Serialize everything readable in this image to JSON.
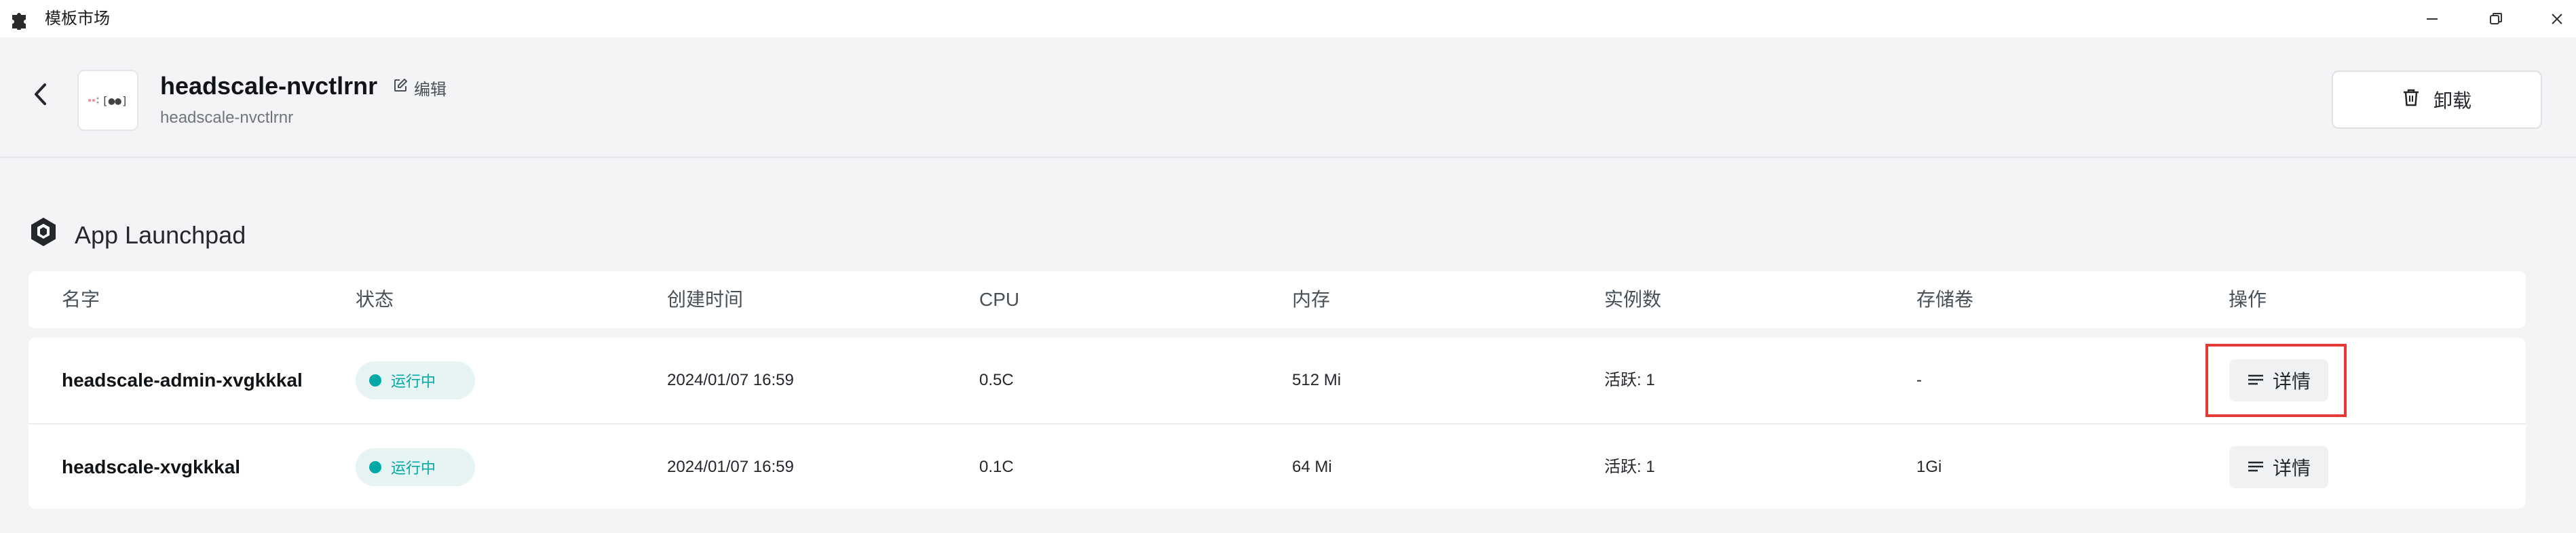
{
  "window": {
    "title": "模板市场",
    "icon": "puzzle-icon",
    "controls": [
      "minimize-icon",
      "restore-icon",
      "close-icon"
    ]
  },
  "header": {
    "back_icon": "chevron-left-icon",
    "app_name": "headscale-nvctlrnr",
    "edit_label": "编辑",
    "app_subtitle": "headscale-nvctlrnr",
    "logo_text": "[●●]",
    "uninstall_label": "卸载"
  },
  "section": {
    "title": "App Launchpad",
    "icon": "hexagon-cube-icon"
  },
  "table": {
    "columns": [
      "名字",
      "状态",
      "创建时间",
      "CPU",
      "内存",
      "实例数",
      "存储卷",
      "操作"
    ],
    "rows": [
      {
        "name": "headscale-admin-xvgkkkal",
        "status": "运行中",
        "created": "2024/01/07 16:59",
        "cpu": "0.5C",
        "memory": "512 Mi",
        "replicas": "活跃: 1",
        "storage": "-",
        "action": "详情"
      },
      {
        "name": "headscale-xvgkkkal",
        "status": "运行中",
        "created": "2024/01/07 16:59",
        "cpu": "0.1C",
        "memory": "64 Mi",
        "replicas": "活跃: 1",
        "storage": "1Gi",
        "action": "详情"
      }
    ]
  },
  "colors": {
    "status_running": "#00a9a6",
    "highlight": "#e53935",
    "background": "#f4f4f7"
  }
}
